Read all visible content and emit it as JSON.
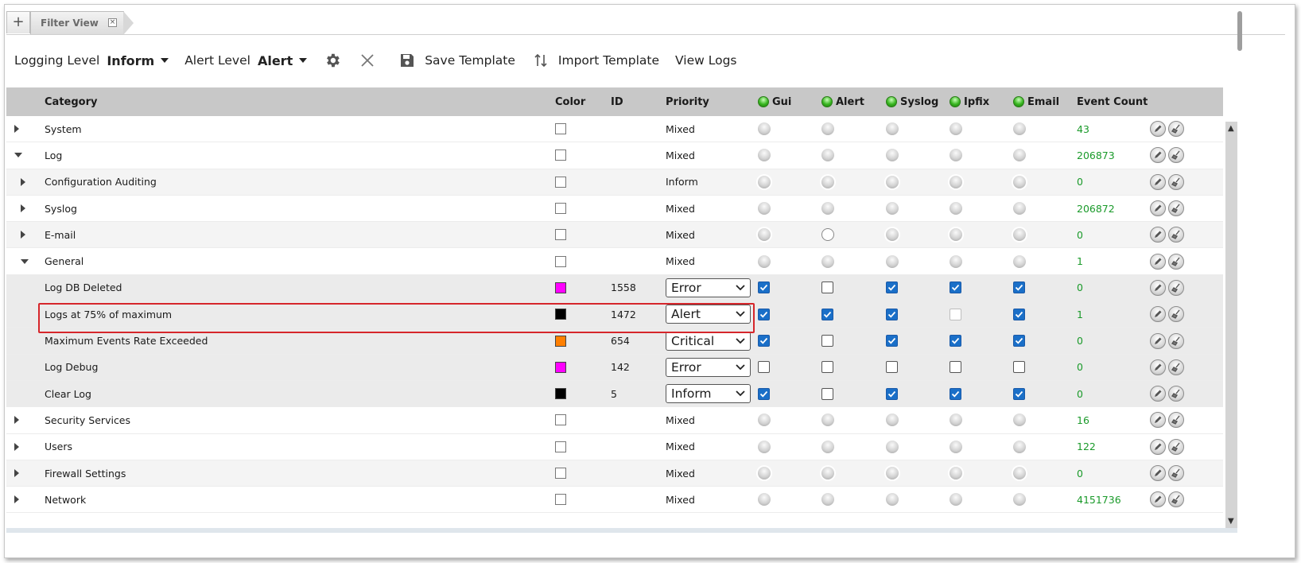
{
  "tabs": {
    "add_label": "+",
    "filter_view": "Filter View",
    "close_label": "×"
  },
  "toolbar": {
    "logging_level_label": "Logging Level",
    "logging_level_value": "Inform",
    "alert_level_label": "Alert Level",
    "alert_level_value": "Alert",
    "save_template": "Save Template",
    "import_template": "Import Template",
    "view_logs": "View Logs"
  },
  "columns": {
    "category": "Category",
    "color": "Color",
    "id": "ID",
    "priority": "Priority",
    "gui": "Gui",
    "alert": "Alert",
    "syslog": "Syslog",
    "ipfix": "Ipfix",
    "email": "Email",
    "event_count": "Event Count"
  },
  "rows": [
    {
      "label": "System",
      "priority": "Mixed",
      "count": "43"
    },
    {
      "label": "Log",
      "priority": "Mixed",
      "count": "206873"
    },
    {
      "label": "Configuration Auditing",
      "priority": "Inform",
      "count": "0"
    },
    {
      "label": "Syslog",
      "priority": "Mixed",
      "count": "206872"
    },
    {
      "label": "E-mail",
      "priority": "Mixed",
      "count": "0"
    },
    {
      "label": "General",
      "priority": "Mixed",
      "count": "1"
    },
    {
      "label": "Log DB Deleted",
      "id": "1558",
      "priority": "Error",
      "count": "0"
    },
    {
      "label": "Logs at 75% of maximum",
      "id": "1472",
      "priority": "Alert",
      "count": "1"
    },
    {
      "label": "Maximum Events Rate Exceeded",
      "id": "654",
      "priority": "Critical",
      "count": "0"
    },
    {
      "label": "Log Debug",
      "id": "142",
      "priority": "Error",
      "count": "0"
    },
    {
      "label": "Clear Log",
      "id": "5",
      "priority": "Inform",
      "count": "0"
    },
    {
      "label": "Security Services",
      "priority": "Mixed",
      "count": "16"
    },
    {
      "label": "Users",
      "priority": "Mixed",
      "count": "122"
    },
    {
      "label": "Firewall Settings",
      "priority": "Mixed",
      "count": "0"
    },
    {
      "label": "Network",
      "priority": "Mixed",
      "count": "4151736"
    }
  ],
  "colors": {
    "magenta": "#ff00ff",
    "black": "#000000",
    "orange": "#ff7f00",
    "count_green": "#1a9a2a",
    "highlight_red": "#d6262b"
  }
}
